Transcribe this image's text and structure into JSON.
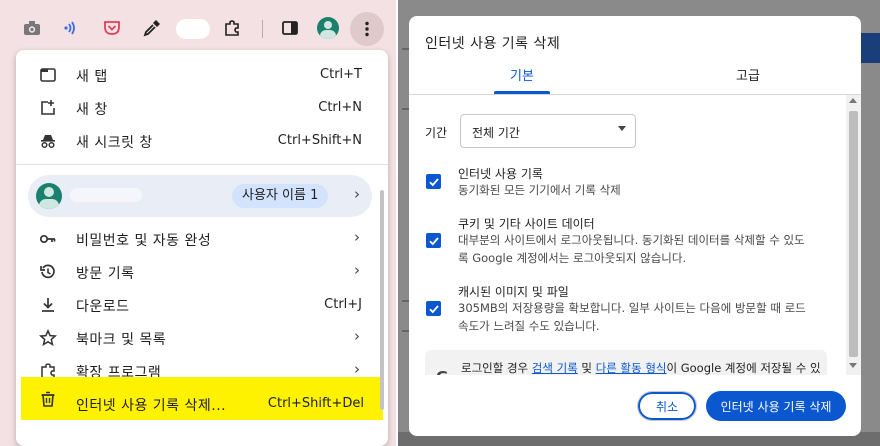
{
  "toolbar": {
    "icons": [
      "camera-icon",
      "cast-icon",
      "pocket-icon",
      "eyedropper-icon",
      "extension-icon",
      "sidepanel-icon",
      "avatar",
      "kebab-menu-icon"
    ]
  },
  "menu": {
    "new_tab": {
      "label": "새 탭",
      "shortcut": "Ctrl+T"
    },
    "new_window": {
      "label": "새 창",
      "shortcut": "Ctrl+N"
    },
    "incognito": {
      "label": "새 시크릿 창",
      "shortcut": "Ctrl+Shift+N"
    },
    "profile": {
      "chip": "사용자 이름 1"
    },
    "passwords": {
      "label": "비밀번호 및 자동 완성"
    },
    "history": {
      "label": "방문 기록"
    },
    "downloads": {
      "label": "다운로드",
      "shortcut": "Ctrl+J"
    },
    "bookmarks": {
      "label": "북마크 및 목록"
    },
    "extensions": {
      "label": "확장 프로그램"
    },
    "clear_data": {
      "label": "인터넷 사용 기록 삭제...",
      "shortcut": "Ctrl+Shift+Del"
    },
    "arrow": "›",
    "highlight_color": "#fff200"
  },
  "dialog": {
    "title": "인터넷 사용 기록 삭제",
    "tabs": {
      "basic": "기본",
      "advanced": "고급"
    },
    "range": {
      "label": "기간",
      "value": "전체 기간"
    },
    "options": [
      {
        "title": "인터넷 사용 기록",
        "desc": [
          "동기화된 모든 기기에서 기록 삭제"
        ],
        "checked": true
      },
      {
        "title": "쿠키 및 기타 사이트 데이터",
        "desc": [
          "대부분의 사이트에서 로그아웃됩니다. 동기화된 데이터를 삭제할 수 있도",
          "록 Google 계정에서는 로그아웃되지 않습니다."
        ],
        "checked": true
      },
      {
        "title": "캐시된 이미지 및 파일",
        "desc": [
          "305MB의 저장용량을 확보합니다. 일부 사이트는 다음에 방문할 때 로드",
          "속도가 느려질 수도 있습니다."
        ],
        "checked": true
      }
    ],
    "google_note": {
      "g": "G",
      "part1": "로그인할 경우 ",
      "link1": "검색 기록",
      "part2": " 및 ",
      "link2": "다른 활동 형식",
      "part3": "이 Google 계정에 저장될 수 있습니다. 이러한 데이터는 언제든지 삭제할 수 있습니다."
    },
    "cancel_label": "취소",
    "confirm_label": "인터넷 사용 기록 삭제",
    "accent_color": "#0b57d0"
  }
}
